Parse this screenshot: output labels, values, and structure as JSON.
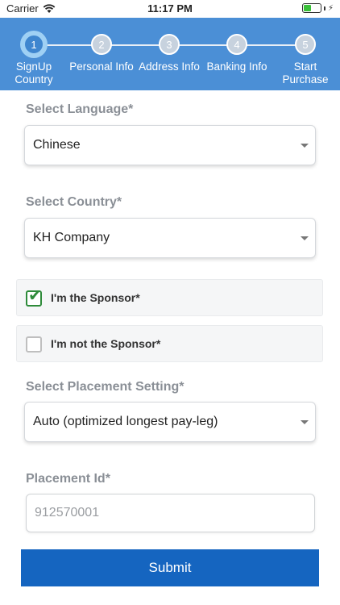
{
  "status_bar": {
    "carrier": "Carrier",
    "time": "11:17 PM"
  },
  "stepper": {
    "steps": [
      {
        "number": "1",
        "label_line1": "SignUp",
        "label_line2": "Country",
        "active": true
      },
      {
        "number": "2",
        "label_line1": "Personal Info",
        "label_line2": ""
      },
      {
        "number": "3",
        "label_line1": "Address Info",
        "label_line2": ""
      },
      {
        "number": "4",
        "label_line1": "Banking Info",
        "label_line2": ""
      },
      {
        "number": "5",
        "label_line1": "Start",
        "label_line2": "Purchase"
      }
    ]
  },
  "form": {
    "language_label": "Select Language*",
    "language_value": "Chinese",
    "country_label": "Select Country*",
    "country_value": "KH Company",
    "sponsor_yes_label": "I'm the Sponsor*",
    "sponsor_yes_checked": true,
    "sponsor_no_label": "I'm not the Sponsor*",
    "sponsor_no_checked": false,
    "placement_label": "Select Placement Setting*",
    "placement_value": "Auto (optimized longest pay-leg)",
    "placement_id_label": "Placement Id*",
    "placement_id_placeholder": "912570001",
    "submit_label": "Submit"
  },
  "colors": {
    "header": "#4b8fd6",
    "submit": "#1565c0",
    "check": "#2e8b3a"
  }
}
